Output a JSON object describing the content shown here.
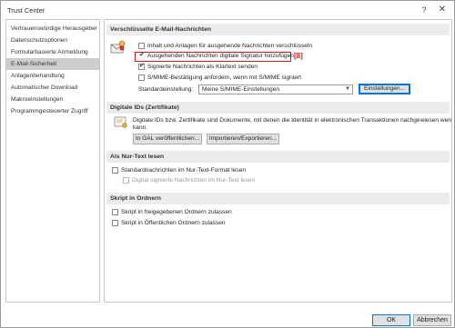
{
  "window": {
    "title": "Trust Center",
    "help_label": "?",
    "close_label": "✕"
  },
  "sidebar": {
    "items": [
      {
        "label": "Vertrauenswürdige Herausgeber"
      },
      {
        "label": "Datenschutzoptionen"
      },
      {
        "label": "Formularbasierte Anmeldung"
      },
      {
        "label": "E-Mail-Sicherheit",
        "selected": true
      },
      {
        "label": "Anlagenbehandlung"
      },
      {
        "label": "Automatischer Download"
      },
      {
        "label": "Makroeinstellungen"
      },
      {
        "label": "Programmgesteuerter Zugriff"
      }
    ]
  },
  "encrypted": {
    "header": "Verschlüsselte E-Mail-Nachrichten",
    "opt_encrypt": "Inhalt und Anlagen für ausgehende Nachrichten verschlüsseln",
    "opt_sign": "Ausgehenden Nachrichten digitale Signatur hinzufügen",
    "opt_cleartext": "Signierte Nachrichten als Klartext senden",
    "opt_receipt": "S/MIME-Bestätigung anfordern, wenn mit S/MIME signiert",
    "default_setting_label": "Standardeinstellung:",
    "default_setting_value": "Meine S/MIME-Einstellungen",
    "settings_button": "Einstellungen...",
    "callout": "[8]"
  },
  "digital_ids": {
    "header": "Digitale IDs (Zertifikate)",
    "description": "Digitale IDs bzw. Zertifikate sind Dokumente, mit denen die Identität in elektronischen Transaktionen nachgewiesen werden",
    "description2": "kann.",
    "publish_button": "In GAL veröffentlichen...",
    "import_button": "Importieren/Exportieren..."
  },
  "plaintext": {
    "header": "Als Nur-Text lesen",
    "opt_read_plain": "Standardnachrichten im Nur-Text-Format lesen",
    "opt_read_signed": "Digital signierte Nachrichten im Nur-Text lesen"
  },
  "folder_script": {
    "header": "Skript in Ordnern",
    "opt_shared": "Skript in freigegebenen Ordnern zulassen",
    "opt_public": "Skript in Öffentlichen Ordnern zulassen"
  },
  "footer": {
    "ok_label": "OK",
    "cancel_label": "Abbrechen"
  },
  "colors": {
    "highlight": "#d21c1c",
    "selected_nav": "#cdcdcd",
    "section_bg": "#ececec",
    "focus_blue": "#0078d7"
  }
}
